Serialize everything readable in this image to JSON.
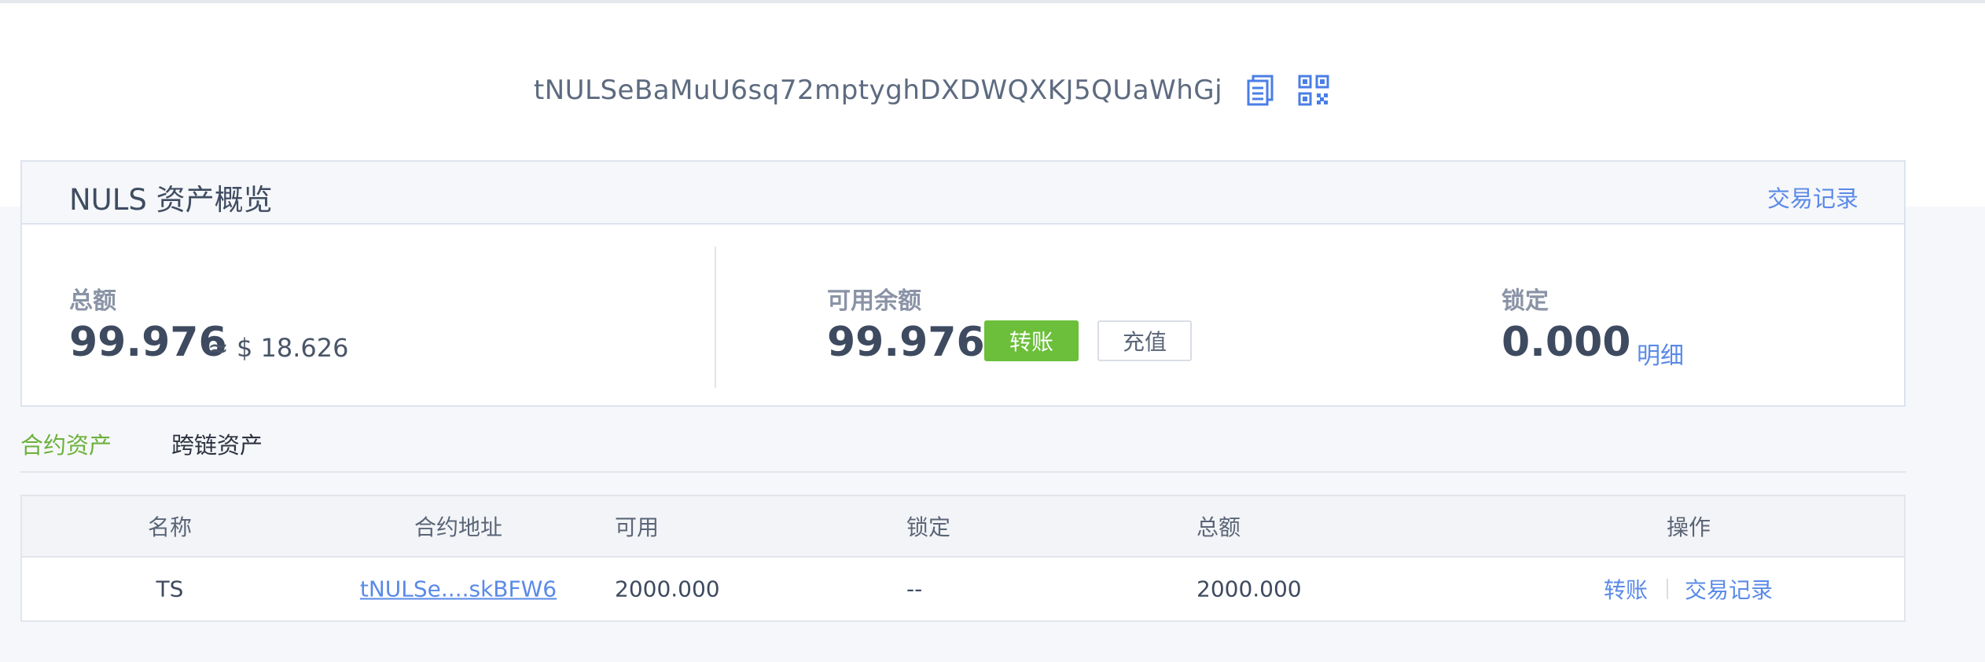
{
  "address": {
    "value": "tNULSeBaMuU6sq72mptyghDXDWQXKJ5QUaWhGj",
    "copy_icon": "copy-icon",
    "qr_icon": "qrcode-icon"
  },
  "overview": {
    "title": "NULS 资产概览",
    "tx_record_label": "交易记录",
    "total": {
      "label": "总额",
      "value": "99.976",
      "approx": "≈ $ 18.626"
    },
    "available": {
      "label": "可用余额",
      "value": "99.976",
      "transfer_label": "转账",
      "recharge_label": "充值"
    },
    "locked": {
      "label": "锁定",
      "value": "0.000",
      "detail_label": "明细"
    }
  },
  "tabs": [
    {
      "label": "合约资产",
      "active": true
    },
    {
      "label": "跨链资产",
      "active": false
    }
  ],
  "table": {
    "headers": [
      "名称",
      "合约地址",
      "可用",
      "锁定",
      "总额",
      "操作"
    ],
    "rows": [
      {
        "name": "TS",
        "contract_address": "tNULSe....skBFW6",
        "available": "2000.000",
        "locked": "--",
        "total": "2000.000",
        "actions": [
          "转账",
          "交易记录"
        ]
      }
    ]
  },
  "colors": {
    "accent_blue": "#5a8ae8",
    "accent_green": "#6bbf3a",
    "text_dark": "#3e4a5f"
  }
}
